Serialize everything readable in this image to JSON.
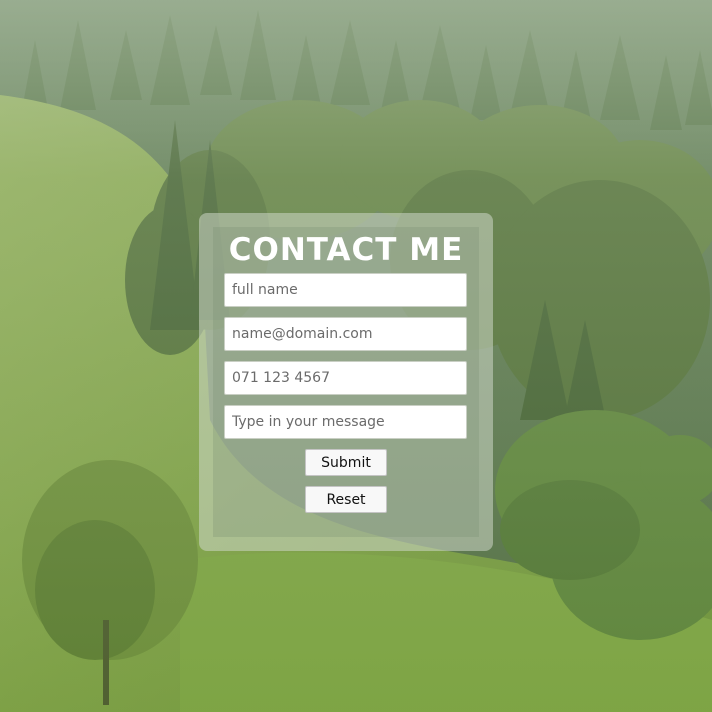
{
  "page": {
    "title": "CONTACT ME"
  },
  "form": {
    "name_placeholder": "full name",
    "email_placeholder": "name@domain.com",
    "phone_placeholder": "071 123 4567",
    "message_placeholder": "Type in your message",
    "submit_label": "Submit",
    "reset_label": "Reset"
  },
  "colors": {
    "title_text": "#ffffff",
    "card_overlay": "#cdd7c8",
    "field_background": "#ffffff",
    "button_background": "#f8f8f8"
  }
}
